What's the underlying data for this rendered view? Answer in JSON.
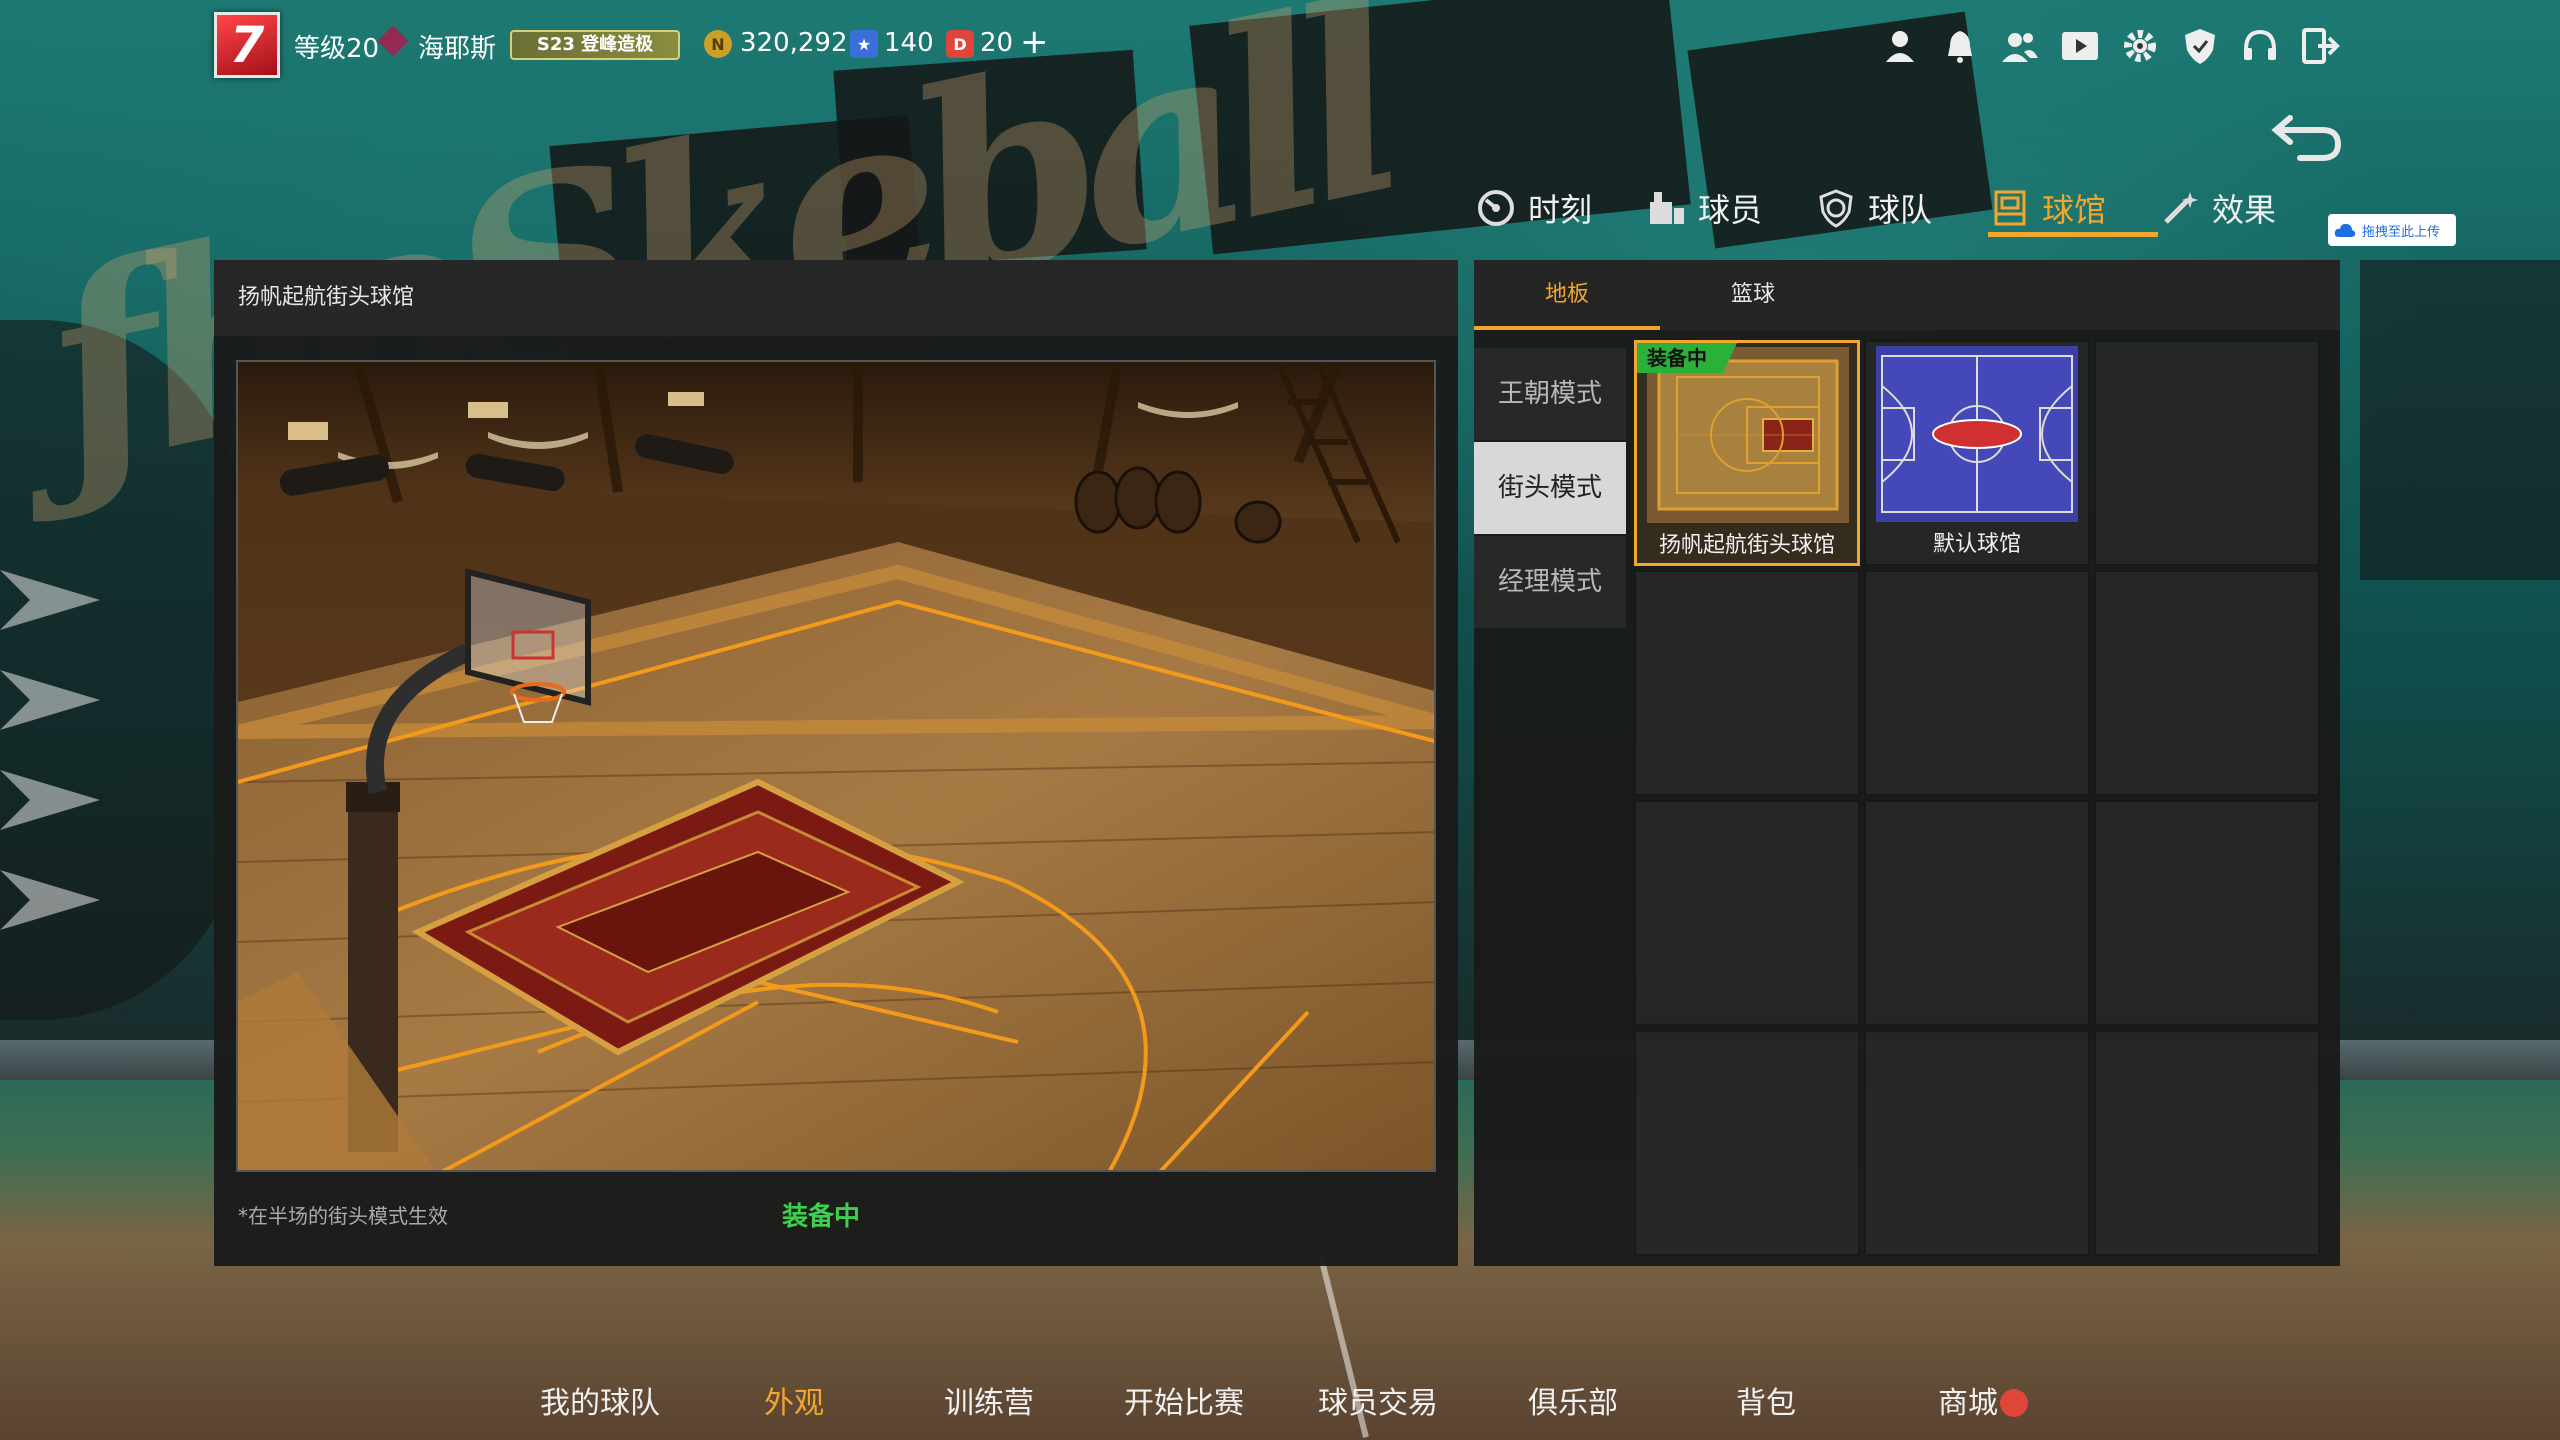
{
  "topbar": {
    "level_badge": "7",
    "level_label": "等级20",
    "player_name": "海耶斯",
    "rank_badge": "S23 登峰造极",
    "coins": "320,292",
    "stars": "140",
    "tickets": "20",
    "plus": "+",
    "icons": [
      "profile-icon",
      "bell-icon",
      "friends-icon",
      "video-icon",
      "gear-icon",
      "shield-icon",
      "headset-icon",
      "exit-icon"
    ]
  },
  "category_tabs": [
    {
      "label": "时刻",
      "icon": "moment-icon"
    },
    {
      "label": "球员",
      "icon": "player-icon"
    },
    {
      "label": "球队",
      "icon": "team-icon"
    },
    {
      "label": "球馆",
      "icon": "arena-icon"
    },
    {
      "label": "效果",
      "icon": "effect-icon"
    }
  ],
  "active_category": "球馆",
  "upload_chip": "拖拽至此上传",
  "preview": {
    "title": "扬帆起航街头球馆",
    "note": "*在半场的街头模式生效",
    "status": "装备中"
  },
  "sub_tabs": [
    {
      "label": "地板"
    },
    {
      "label": "篮球"
    }
  ],
  "modes": [
    {
      "label": "王朝模式"
    },
    {
      "label": "街头模式"
    },
    {
      "label": "经理模式"
    }
  ],
  "items": [
    {
      "label": "扬帆起航街头球馆",
      "tag": "装备中"
    },
    {
      "label": "默认球馆"
    }
  ],
  "bottom_nav": [
    {
      "label": "我的球队"
    },
    {
      "label": "外观"
    },
    {
      "label": "训练营"
    },
    {
      "label": "开始比赛"
    },
    {
      "label": "球员交易"
    },
    {
      "label": "俱乐部"
    },
    {
      "label": "背包"
    },
    {
      "label": "商城"
    }
  ],
  "colors": {
    "accent": "#f2a62d",
    "equipped_green": "#3cd14c",
    "panel": "#1a1a1a"
  }
}
